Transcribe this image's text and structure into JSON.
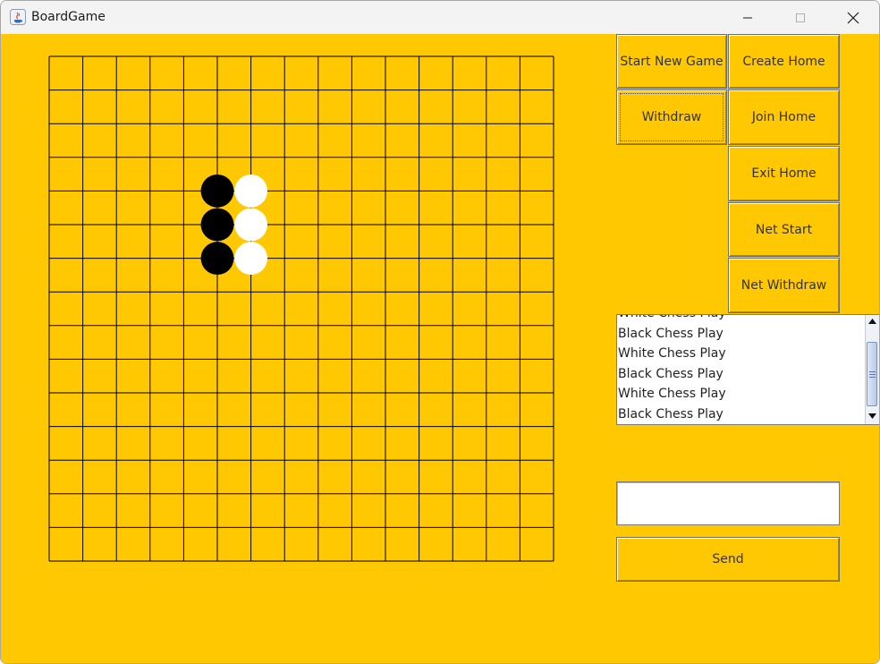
{
  "window": {
    "title": "BoardGame",
    "controls": [
      "minimize",
      "maximize",
      "close"
    ]
  },
  "board": {
    "rows": 15,
    "cols": 15,
    "line_color": "#000000",
    "background": "#ffc800",
    "stones": [
      {
        "color": "black",
        "col": 5,
        "row": 4
      },
      {
        "color": "white",
        "col": 6,
        "row": 4
      },
      {
        "color": "black",
        "col": 5,
        "row": 5
      },
      {
        "color": "white",
        "col": 6,
        "row": 5
      },
      {
        "color": "black",
        "col": 5,
        "row": 6
      },
      {
        "color": "white",
        "col": 6,
        "row": 6
      }
    ]
  },
  "buttons": {
    "start_new_game": "Start New Game",
    "create_home": "Create Home",
    "withdraw": "Withdraw",
    "join_home": "Join Home",
    "exit_home": "Exit Home",
    "net_start": "Net Start",
    "net_withdraw": "Net Withdraw",
    "send": "Send"
  },
  "log": {
    "lines": [
      "White Chess Play",
      "Black Chess Play",
      "White Chess Play",
      "Black Chess Play",
      "White Chess Play",
      "Black Chess Play"
    ]
  },
  "message_input": {
    "value": "",
    "placeholder": ""
  },
  "colors": {
    "panel": "#ffc800",
    "titlebar": "#f3f3f3"
  }
}
